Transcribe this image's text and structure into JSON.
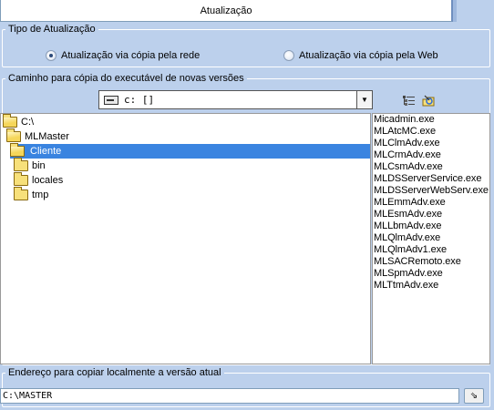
{
  "tab": {
    "title": "Atualização"
  },
  "update_type": {
    "legend": "Tipo de Atualização",
    "options": [
      {
        "label": "Atualização via cópia pela rede",
        "selected": true
      },
      {
        "label": "Atualização via cópia pela Web",
        "selected": false
      }
    ]
  },
  "copy_path": {
    "legend": "Caminho para cópia do executável de novas versões",
    "drive_value": "c: []",
    "tree": [
      {
        "label": "C:\\",
        "level": 0,
        "open": true
      },
      {
        "label": "MLMaster",
        "level": 1,
        "open": true
      },
      {
        "label": "Cliente",
        "level": 2,
        "open": true,
        "selected": true
      },
      {
        "label": "bin",
        "level": 3
      },
      {
        "label": "locales",
        "level": 3
      },
      {
        "label": "tmp",
        "level": 3
      }
    ],
    "files": [
      "Micadmin.exe",
      "MLAtcMC.exe",
      "MLClmAdv.exe",
      "MLCrmAdv.exe",
      "MLCsmAdv.exe",
      "MLDSServerService.exe",
      "MLDSServerWebServ.exe",
      "MLEmmAdv.exe",
      "MLEsmAdv.exe",
      "MLLbmAdv.exe",
      "MLQlmAdv.exe",
      "MLQlmAdv1.exe",
      "MLSACRemoto.exe",
      "MLSpmAdv.exe",
      "MLTtmAdv.exe"
    ]
  },
  "local_copy": {
    "legend": "Endereço para copiar localmente a versão atual",
    "value": "C:\\MASTER"
  },
  "colors": {
    "background": "#bcd0ec",
    "selection": "#3a84e0"
  }
}
